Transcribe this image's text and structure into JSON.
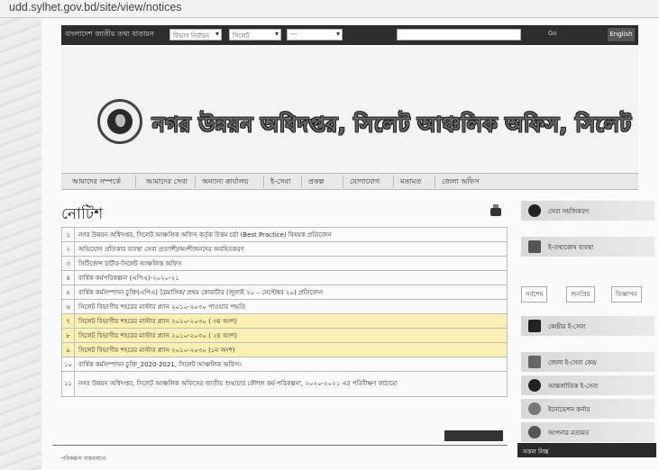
{
  "browser": {
    "url": "udd.sylhet.gov.bd/site/view/notices"
  },
  "topbar": {
    "label": "বাংলাদেশ জাতীয় তথ্য বাতায়ন",
    "select1": "বিভাগ নির্বাচন",
    "select2": "সিলেট",
    "select3": "---",
    "go_label": "Go",
    "lang_label": "English"
  },
  "header": {
    "site_title": "নগর উন্নয়ন অধিদপ্তর, সিলেট আঞ্চলিক অফিস, সিলেট"
  },
  "nav": {
    "items": [
      "আমাদের সম্পর্কে",
      "আমাদের সেবা",
      "অন্যান্য কার্যালয়",
      "ই-সেবা",
      "প্রকল্প",
      "যোগাযোগ",
      "মতামত",
      "জেলা অফিস"
    ]
  },
  "notices": {
    "title": "নোটিশ",
    "rows": [
      {
        "num": "১",
        "text": "নগর উন্নয়ন অধিদপ্তর, সিলেট আঞ্চলিক অফিস কর্তৃক উত্তম চর্চা (Best Practice) বিষয়ক প্রতিবেদন",
        "highlight": false
      },
      {
        "num": "২",
        "text": "অভিযোগ প্রতিকার ব্যবস্থা সেবা প্রত্যাশী/অংশীজনদের অবহিতকরণ",
        "highlight": false
      },
      {
        "num": "৩",
        "text": "সিটিজেন্স চার্টার-সিলেট আঞ্চলিক অফিস",
        "highlight": false
      },
      {
        "num": "৪",
        "text": "বার্ষিক কর্মপরিকল্পনা (এপিএ)-২০২০-২১",
        "highlight": false
      },
      {
        "num": "৫",
        "text": "বার্ষিক কর্মসম্পাদন চুক্তি(এপিএ) ত্রৈমাসিক/ প্রথম কোয়ার্টার (জুলাই ২০ – সেপ্টেম্বর ২০) প্রতিবেদন",
        "highlight": false
      },
      {
        "num": "৬",
        "text": "সিলেট বিভাগীয় শহরের মাস্টার প্ল্যান ২০১০-২০৩০ পাওয়ার পদ্ধতি",
        "highlight": false
      },
      {
        "num": "৭",
        "text": "সিলেট বিভাগীয় শহরের মাস্টার প্ল্যান ২০১০-২০৩০ ( ৩য় অংশ)",
        "highlight": true
      },
      {
        "num": "৮",
        "text": "সিলেট বিভাগীয় শহরের মাস্টার প্ল্যান ২০১০-২০৩০ ( ২য় অংশ)",
        "highlight": true
      },
      {
        "num": "৯",
        "text": "সিলেট বিভাগীয় শহরের মাস্টার প্ল্যান ২০১০-২০৩০ (১ম অংশ)",
        "highlight": true
      },
      {
        "num": "১০",
        "text": "বার্ষিক কর্মসম্পাদন চুক্তি_2020-2021, সিলেট আঞ্চলিক অফিস।",
        "highlight": false
      },
      {
        "num": "১১",
        "text": "নগর উন্নয়ন অধিদপ্তর, সিলেট আঞ্চলিক অফিসের জাতীয় শুদ্ধাচার কৌশল কর্ম-পরিকল্পনা, ২০২০-২০২১ এর পরিবীক্ষণ কাঠামো",
        "highlight": false
      }
    ]
  },
  "sidebar": {
    "box1": "সেবা সহজিকরণ",
    "box2": "ই-তথ্যকোষ ব্যবস্থা",
    "tabs": [
      "সর্বশেষ",
      "জনপ্রিয়",
      "বিজ্ঞাপন"
    ],
    "box3": "কেন্দ্রীয় ই-সেবা",
    "box4": "জেলা ই-সেবা কেন্দ্র",
    "box5": "আন্তর্জাতিক ই-সেবা",
    "box6": "ইনোভেশন কর্নার",
    "box7": "আপনার মতামত",
    "bottom": "সকল লিঙ্ক"
  },
  "footer": {
    "text": "পরিকল্পনা বাস্তবায়নে:"
  }
}
